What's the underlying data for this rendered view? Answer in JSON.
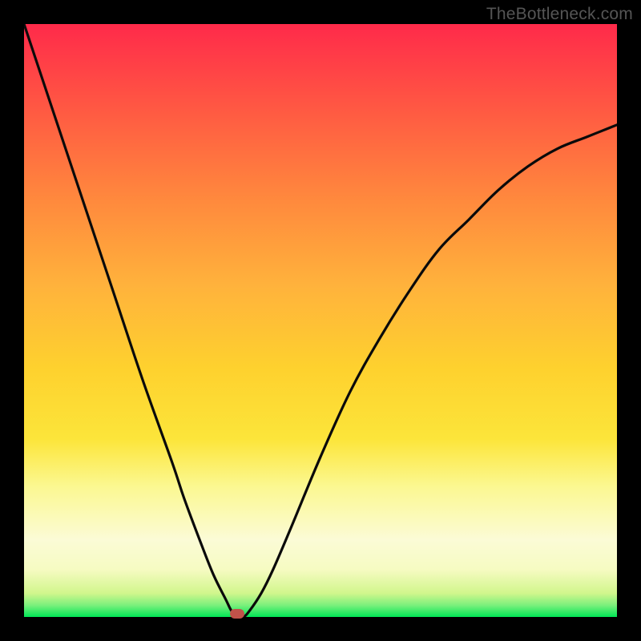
{
  "watermark": "TheBottleneck.com",
  "chart_data": {
    "type": "line",
    "title": "",
    "xlabel": "",
    "ylabel": "",
    "xlim": [
      0,
      100
    ],
    "ylim": [
      0,
      100
    ],
    "grid": false,
    "series": [
      {
        "name": "bottleneck-curve",
        "x": [
          0,
          5,
          10,
          15,
          20,
          25,
          27,
          30,
          32,
          34,
          35,
          36,
          37,
          38,
          40,
          42,
          45,
          50,
          55,
          60,
          65,
          70,
          75,
          80,
          85,
          90,
          95,
          100
        ],
        "values": [
          100,
          85,
          70,
          55,
          40,
          26,
          20,
          12,
          7,
          3,
          1,
          0,
          0,
          1,
          4,
          8,
          15,
          27,
          38,
          47,
          55,
          62,
          67,
          72,
          76,
          79,
          81,
          83
        ]
      }
    ],
    "marker": {
      "x": 36,
      "y": 0
    },
    "background_gradient": {
      "top": "#ff2a4a",
      "mid": "#fce53a",
      "bottom": "#00e756"
    }
  }
}
